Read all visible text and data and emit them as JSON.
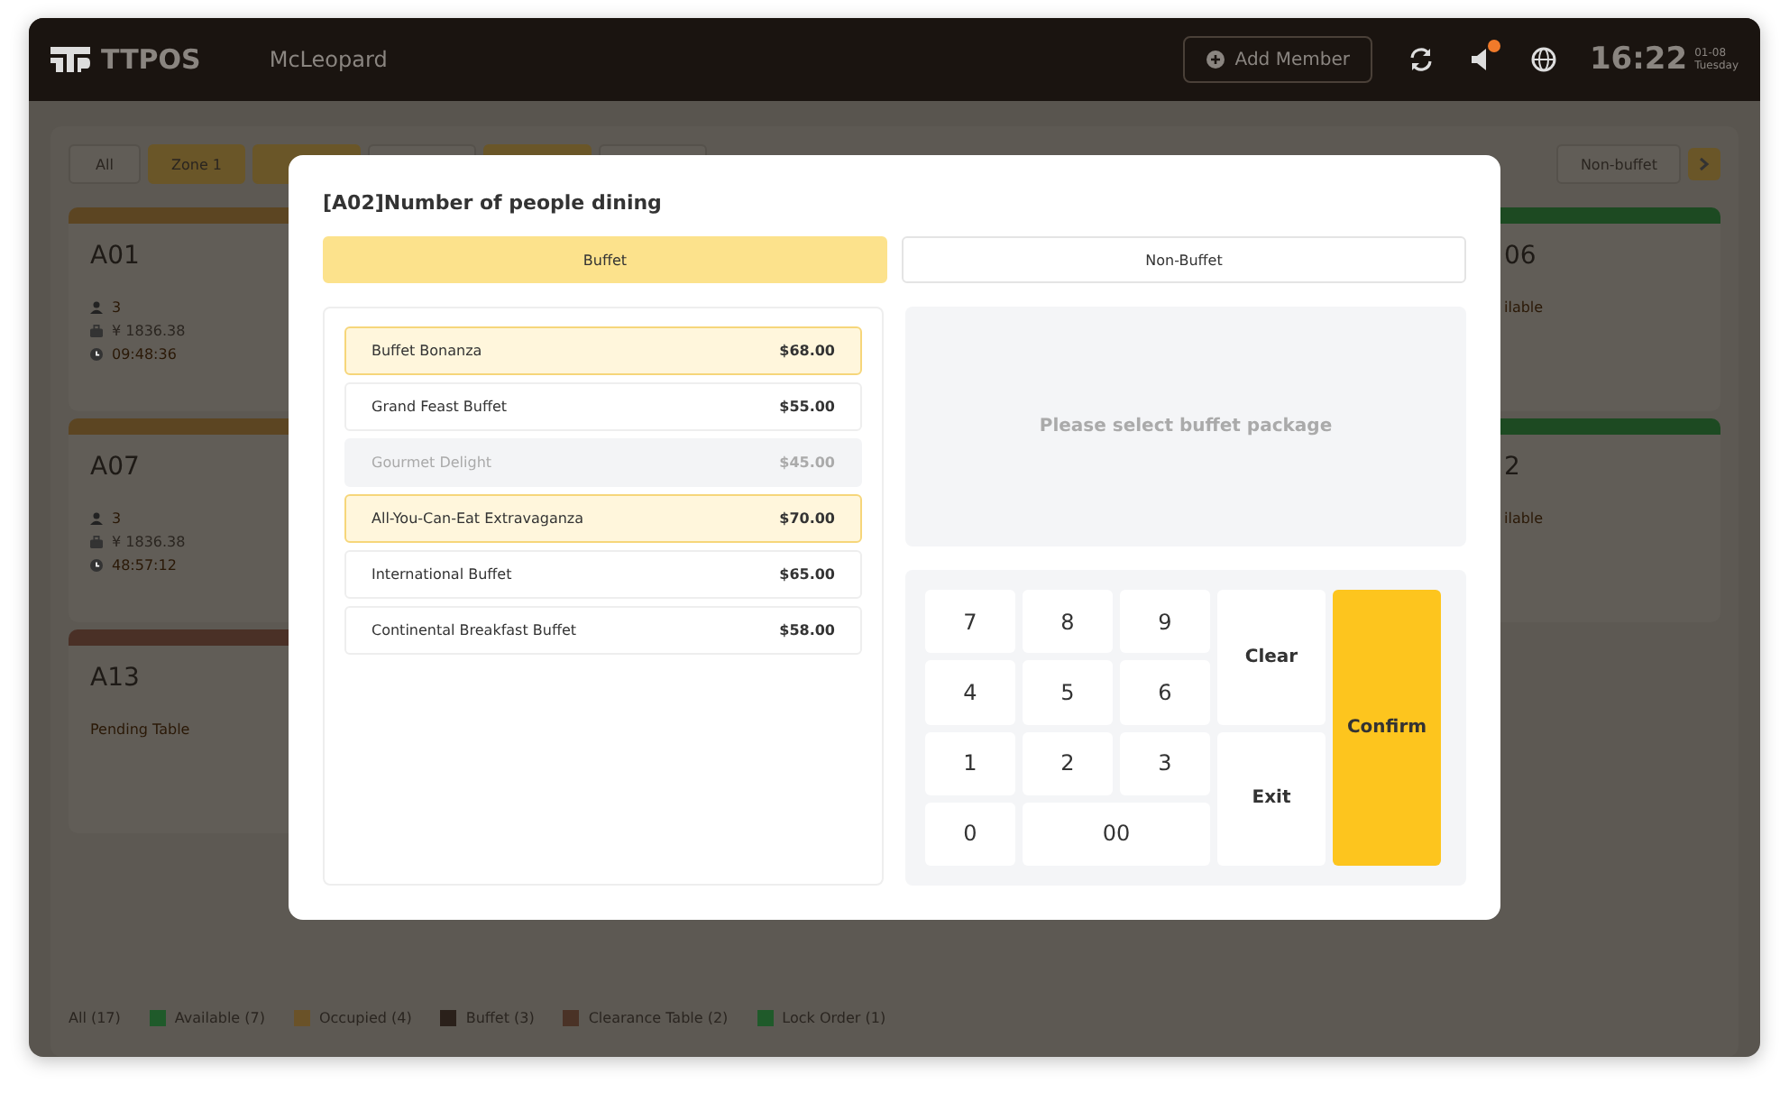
{
  "header": {
    "brand": "TTPOS",
    "store": "McLeopard",
    "add_member": "Add Member",
    "notification_badge": true,
    "time": "16:22",
    "date": "01-08",
    "weekday": "Tuesday"
  },
  "zone_tabs": [
    {
      "label": "All",
      "selected": false
    },
    {
      "label": "Zone 1",
      "selected": true
    },
    {
      "selected": true
    },
    {
      "selected": false
    },
    {
      "selected": true
    },
    {
      "selected": false
    },
    {
      "label": "Non-buffet",
      "selected": false
    }
  ],
  "left_tables": [
    {
      "name": "A01",
      "kind": "occupied",
      "color": "#5c4522",
      "guests": "3",
      "amount": "¥ 1836.38",
      "time": "09:48:36"
    },
    {
      "name": "A07",
      "kind": "occupied",
      "color": "#5c4522",
      "guests": "3",
      "amount": "¥ 1836.38",
      "time": "48:57:12"
    },
    {
      "name": "A13",
      "kind": "status",
      "color": "#4a3026",
      "status": "Pending Table"
    }
  ],
  "right_tables": [
    {
      "name": "06",
      "kind": "status",
      "color": "#1d4a22",
      "status": "ilable"
    },
    {
      "name": "2",
      "kind": "status",
      "color": "#1d4a22",
      "status": "ilable"
    }
  ],
  "legend": [
    {
      "label": "All (17)"
    },
    {
      "label": "Available (7)",
      "color": "#1f5a2a"
    },
    {
      "label": "Occupied (4)",
      "color": "#6a5228"
    },
    {
      "label": "Buffet (3)",
      "color": "#2a201a"
    },
    {
      "label": "Clearance Table (2)",
      "color": "#4a3226"
    },
    {
      "label": "Lock Order (1)",
      "color": "#1f5a2a"
    }
  ],
  "dialog": {
    "title": "[A02]Number of people dining",
    "modes": [
      {
        "label": "Buffet",
        "selected": true
      },
      {
        "label": "Non-Buffet",
        "selected": false
      }
    ],
    "packages": [
      {
        "name": "Buffet Bonanza",
        "price": "$68.00",
        "selected": true,
        "disabled": false
      },
      {
        "name": "Grand Feast Buffet",
        "price": "$55.00",
        "selected": false,
        "disabled": false
      },
      {
        "name": "Gourmet Delight",
        "price": "$45.00",
        "selected": false,
        "disabled": true
      },
      {
        "name": "All-You-Can-Eat Extravaganza",
        "price": "$70.00",
        "selected": true,
        "disabled": false
      },
      {
        "name": "International Buffet",
        "price": "$65.00",
        "selected": false,
        "disabled": false
      },
      {
        "name": "Continental Breakfast Buffet",
        "price": "$58.00",
        "selected": false,
        "disabled": false
      }
    ],
    "preview_message": "Please select buffet package",
    "keys": [
      {
        "label": "7",
        "kind": "digit"
      },
      {
        "label": "8",
        "kind": "digit"
      },
      {
        "label": "9",
        "kind": "digit"
      },
      {
        "label": "Clear",
        "kind": "clear"
      },
      {
        "label": "Confirm",
        "kind": "confirm"
      },
      {
        "label": "4",
        "kind": "digit"
      },
      {
        "label": "5",
        "kind": "digit"
      },
      {
        "label": "6",
        "kind": "digit"
      },
      {
        "label": "1",
        "kind": "digit"
      },
      {
        "label": "2",
        "kind": "digit"
      },
      {
        "label": "3",
        "kind": "digit"
      },
      {
        "label": "Exit",
        "kind": "exit"
      },
      {
        "label": "0",
        "kind": "digit"
      },
      {
        "label": "00",
        "kind": "wide"
      }
    ]
  }
}
